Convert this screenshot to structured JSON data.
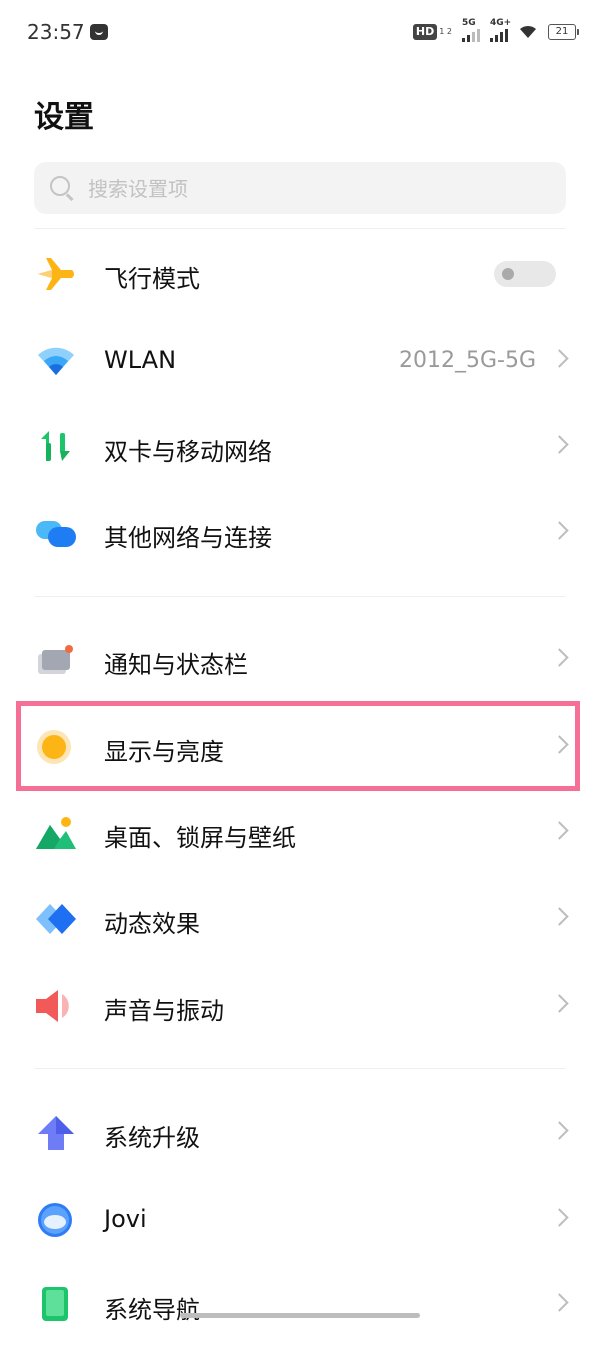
{
  "status_bar": {
    "time": "23:57",
    "hd_label": "HD",
    "hd_sub": "1 2",
    "net1": "5G",
    "net2": "4G+",
    "battery": "21"
  },
  "page": {
    "title": "设置"
  },
  "search": {
    "placeholder": "搜索设置项"
  },
  "items": [
    {
      "label": "飞行模式",
      "type": "toggle",
      "toggle_on": false,
      "icon": "airplane-icon"
    },
    {
      "label": "WLAN",
      "value": "2012_5G-5G",
      "icon": "wifi-icon"
    },
    {
      "label": "双卡与移动网络",
      "icon": "mobile-network-icon"
    },
    {
      "label": "其他网络与连接",
      "icon": "connection-icon"
    },
    {
      "label": "通知与状态栏",
      "icon": "notification-icon"
    },
    {
      "label": "显示与亮度",
      "icon": "brightness-icon",
      "highlighted": true
    },
    {
      "label": "桌面、锁屏与壁纸",
      "icon": "wallpaper-icon"
    },
    {
      "label": "动态效果",
      "icon": "dynamic-effect-icon"
    },
    {
      "label": "声音与振动",
      "icon": "sound-icon"
    },
    {
      "label": "系统升级",
      "icon": "system-upgrade-icon"
    },
    {
      "label": "Jovi",
      "icon": "jovi-icon"
    },
    {
      "label": "系统导航",
      "icon": "system-navigation-icon"
    }
  ],
  "colors": {
    "highlight": "#f56f97",
    "accent_yellow": "#fdb515",
    "accent_blue": "#2f7cf6"
  }
}
